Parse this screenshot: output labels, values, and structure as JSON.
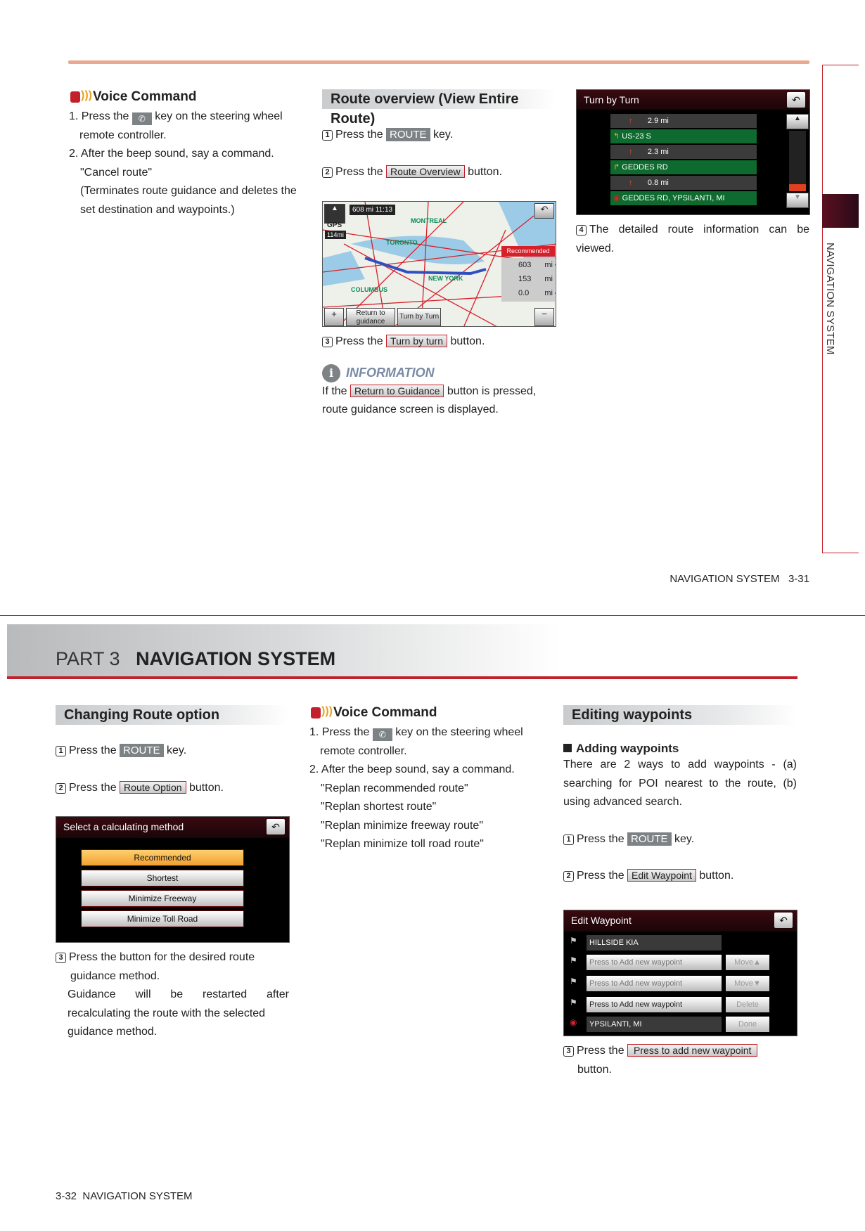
{
  "page_top": {
    "side_tab": "NAVIGATION SYSTEM",
    "footer": {
      "section": "NAVIGATION SYSTEM",
      "page": "3-31"
    },
    "voice": {
      "title": "Voice Command",
      "step1_a": "1. Press the",
      "step1_b": "key on the steering wheel",
      "step1_c": "remote controller.",
      "step2": "2. After the beep sound, say a command.",
      "cmd": "\"Cancel route\"",
      "note": "(Terminates route guidance and deletes the set destination and waypoints.)"
    },
    "route_overview": {
      "title": "Route overview (View Entire Route)",
      "press_the": "Press the",
      "key": "key.",
      "button": "button.",
      "route_key": "ROUTE",
      "overview_btn": "Route Overview",
      "tbt_btn": "Turn by turn",
      "map": {
        "dist_time": "608 mi  11:13",
        "gps": "GPS",
        "scale": "114mi",
        "recommended": "Recommended",
        "stats": [
          {
            "v": "603",
            "u": "mi"
          },
          {
            "v": "153",
            "u": "mi"
          },
          {
            "v": "0.0",
            "u": "mi"
          }
        ],
        "return_btn": "Return to guidance",
        "tbt_btn": "Turn by Turn",
        "cities": [
          "TORONTO",
          "NEW YORK",
          "COLUMBUS",
          "MONTREAL"
        ]
      },
      "info_title": "INFORMATION",
      "info_a": "If the",
      "info_btn": "Return to Guidance",
      "info_b": "button is pressed,",
      "info_c": "route guidance screen is displayed."
    },
    "tbt": {
      "title": "Turn by Turn",
      "rows": [
        "2.9 mi",
        "US-23 S",
        "2.3 mi",
        "GEDDES RD",
        "0.8 mi",
        "GEDDES RD, YPSILANTI, MI"
      ],
      "step4": "The detailed route information can be viewed."
    }
  },
  "page_bottom": {
    "part": "PART 3",
    "part_title": "NAVIGATION SYSTEM",
    "footer": {
      "page": "3-32",
      "section": "NAVIGATION SYSTEM"
    },
    "changing": {
      "title": "Changing Route option",
      "press_the": "Press the",
      "key": "key.",
      "button": "button.",
      "route_key": "ROUTE",
      "option_btn": "Route Option",
      "screen": {
        "title": "Select a calculating method",
        "options": [
          "Recommended",
          "Shortest",
          "Minimize Freeway",
          "Minimize Toll Road"
        ]
      },
      "step3_a": "Press the button for the desired route",
      "step3_b": "guidance method.",
      "note_a": "Guidance will be restarted after",
      "note_b": "recalculating the route with the selected",
      "note_c": "guidance method."
    },
    "voice": {
      "title": "Voice Command",
      "step1_a": "1. Press the",
      "step1_b": "key on the steering wheel",
      "step1_c": "remote controller.",
      "step2": "2. After the beep sound, say a command.",
      "cmds": [
        "\"Replan recommended route\"",
        "\"Replan shortest route\"",
        "\"Replan minimize freeway route\"",
        "\"Replan minimize toll road route\""
      ]
    },
    "editing": {
      "title": "Editing waypoints",
      "sub": "Adding waypoints",
      "desc": [
        "There are 2 ways to add waypoints - (a)",
        "searching for POI nearest to the route, (b)",
        "using advanced search."
      ],
      "press_the": "Press the",
      "key": "key.",
      "button": "button.",
      "route_key": "ROUTE",
      "edit_btn": "Edit Waypoint",
      "add_btn": "Press to add new waypoint",
      "screen": {
        "title": "Edit Waypoint",
        "rows": [
          "HILLSIDE KIA",
          "Press to Add new waypoint",
          "Press to Add new waypoint",
          "Press to Add new waypoint",
          "YPSILANTI, MI"
        ],
        "buttons": [
          "Move▲",
          "Move▼",
          "Delete",
          "Done"
        ]
      }
    }
  }
}
